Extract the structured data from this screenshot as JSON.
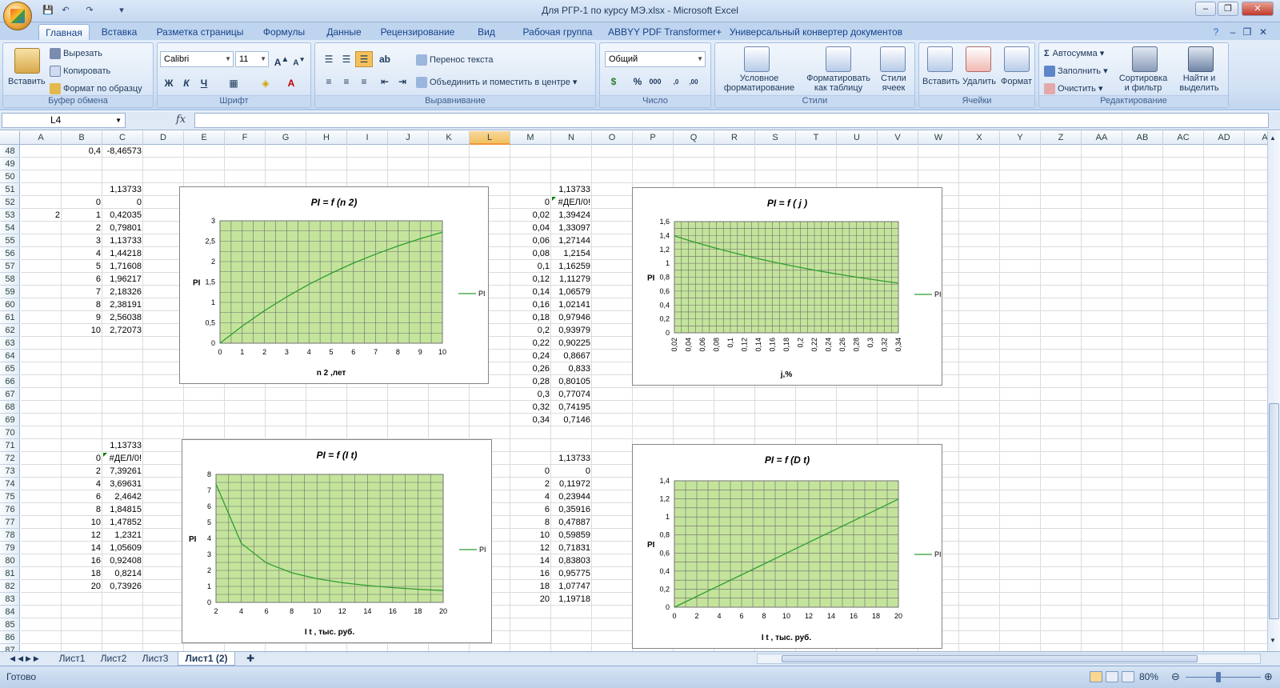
{
  "app": {
    "title": "Для РГР-1 по курсу МЭ.xlsx - Microsoft Excel"
  },
  "tabs": [
    "Главная",
    "Вставка",
    "Разметка страницы",
    "Формулы",
    "Данные",
    "Рецензирование",
    "Вид",
    "Рабочая группа",
    "ABBYY PDF Transformer+",
    "Универсальный конвертер документов"
  ],
  "ribbon": {
    "clipboard": {
      "paste": "Вставить",
      "cut": "Вырезать",
      "copy": "Копировать",
      "format_painter": "Формат по образцу",
      "title": "Буфер обмена"
    },
    "font": {
      "name": "Calibri",
      "size": "11",
      "bold": "Ж",
      "italic": "К",
      "underline": "Ч",
      "title": "Шрифт"
    },
    "alignment": {
      "wrap": "Перенос текста",
      "merge": "Объединить и поместить в центре",
      "title": "Выравнивание"
    },
    "number": {
      "format": "Общий",
      "title": "Число"
    },
    "styles": {
      "conditional": "Условное форматирование",
      "as_table": "Форматировать как таблицу",
      "cell_styles": "Стили ячеек",
      "title": "Стили"
    },
    "cells": {
      "insert": "Вставить",
      "delete": "Удалить",
      "format": "Формат",
      "title": "Ячейки"
    },
    "editing": {
      "autosum": "Автосумма",
      "fill": "Заполнить",
      "clear": "Очистить",
      "sort": "Сортировка и фильтр",
      "find": "Найти и выделить",
      "title": "Редактирование"
    }
  },
  "formula_bar": {
    "name_box": "L4",
    "fx": "fx",
    "value": ""
  },
  "columns": [
    "A",
    "B",
    "C",
    "D",
    "E",
    "F",
    "G",
    "H",
    "I",
    "J",
    "K",
    "L",
    "M",
    "N",
    "O",
    "P",
    "Q",
    "R",
    "S",
    "T",
    "U",
    "V",
    "W",
    "X",
    "Y",
    "Z",
    "AA",
    "AB",
    "AC",
    "AD",
    "A"
  ],
  "rows": [
    "48",
    "49",
    "50",
    "51",
    "52",
    "53",
    "54",
    "55",
    "56",
    "57",
    "58",
    "59",
    "60",
    "61",
    "62",
    "63",
    "64",
    "65",
    "66",
    "67",
    "68",
    "69",
    "70",
    "71",
    "72",
    "73",
    "74",
    "75",
    "76",
    "77",
    "78",
    "79",
    "80",
    "81",
    "82",
    "83",
    "84",
    "85",
    "86",
    "87"
  ],
  "cells": [
    {
      "row": "48",
      "col": "B",
      "v": "0,4"
    },
    {
      "row": "48",
      "col": "C",
      "v": "-8,46573"
    },
    {
      "row": "51",
      "col": "C",
      "v": "1,13733"
    },
    {
      "row": "52",
      "col": "B",
      "v": "0"
    },
    {
      "row": "52",
      "col": "C",
      "v": "0"
    },
    {
      "row": "53",
      "col": "A",
      "v": "2"
    },
    {
      "row": "53",
      "col": "B",
      "v": "1"
    },
    {
      "row": "53",
      "col": "C",
      "v": "0,42035"
    },
    {
      "row": "54",
      "col": "B",
      "v": "2"
    },
    {
      "row": "54",
      "col": "C",
      "v": "0,79801"
    },
    {
      "row": "55",
      "col": "B",
      "v": "3"
    },
    {
      "row": "55",
      "col": "C",
      "v": "1,13733"
    },
    {
      "row": "56",
      "col": "B",
      "v": "4"
    },
    {
      "row": "56",
      "col": "C",
      "v": "1,44218"
    },
    {
      "row": "57",
      "col": "B",
      "v": "5"
    },
    {
      "row": "57",
      "col": "C",
      "v": "1,71608"
    },
    {
      "row": "58",
      "col": "B",
      "v": "6"
    },
    {
      "row": "58",
      "col": "C",
      "v": "1,96217"
    },
    {
      "row": "59",
      "col": "B",
      "v": "7"
    },
    {
      "row": "59",
      "col": "C",
      "v": "2,18326"
    },
    {
      "row": "60",
      "col": "B",
      "v": "8"
    },
    {
      "row": "60",
      "col": "C",
      "v": "2,38191"
    },
    {
      "row": "61",
      "col": "B",
      "v": "9"
    },
    {
      "row": "61",
      "col": "C",
      "v": "2,56038"
    },
    {
      "row": "62",
      "col": "B",
      "v": "10"
    },
    {
      "row": "62",
      "col": "C",
      "v": "2,72073"
    },
    {
      "row": "71",
      "col": "C",
      "v": "1,13733"
    },
    {
      "row": "72",
      "col": "B",
      "v": "0"
    },
    {
      "row": "72",
      "col": "C",
      "v": "#ДЕЛ/0!"
    },
    {
      "row": "73",
      "col": "B",
      "v": "2"
    },
    {
      "row": "73",
      "col": "C",
      "v": "7,39261"
    },
    {
      "row": "74",
      "col": "B",
      "v": "4"
    },
    {
      "row": "74",
      "col": "C",
      "v": "3,69631"
    },
    {
      "row": "75",
      "col": "B",
      "v": "6"
    },
    {
      "row": "75",
      "col": "C",
      "v": "2,4642"
    },
    {
      "row": "76",
      "col": "B",
      "v": "8"
    },
    {
      "row": "76",
      "col": "C",
      "v": "1,84815"
    },
    {
      "row": "77",
      "col": "B",
      "v": "10"
    },
    {
      "row": "77",
      "col": "C",
      "v": "1,47852"
    },
    {
      "row": "78",
      "col": "B",
      "v": "12"
    },
    {
      "row": "78",
      "col": "C",
      "v": "1,2321"
    },
    {
      "row": "79",
      "col": "B",
      "v": "14"
    },
    {
      "row": "79",
      "col": "C",
      "v": "1,05609"
    },
    {
      "row": "80",
      "col": "B",
      "v": "16"
    },
    {
      "row": "80",
      "col": "C",
      "v": "0,92408"
    },
    {
      "row": "81",
      "col": "B",
      "v": "18"
    },
    {
      "row": "81",
      "col": "C",
      "v": "0,8214"
    },
    {
      "row": "82",
      "col": "B",
      "v": "20"
    },
    {
      "row": "82",
      "col": "C",
      "v": "0,73926"
    },
    {
      "row": "51",
      "col": "N",
      "v": "1,13733"
    },
    {
      "row": "52",
      "col": "M",
      "v": "0"
    },
    {
      "row": "52",
      "col": "N",
      "v": "#ДЕЛ/0!"
    },
    {
      "row": "53",
      "col": "M",
      "v": "0,02"
    },
    {
      "row": "53",
      "col": "N",
      "v": "1,39424"
    },
    {
      "row": "54",
      "col": "M",
      "v": "0,04"
    },
    {
      "row": "54",
      "col": "N",
      "v": "1,33097"
    },
    {
      "row": "55",
      "col": "M",
      "v": "0,06"
    },
    {
      "row": "55",
      "col": "N",
      "v": "1,27144"
    },
    {
      "row": "56",
      "col": "M",
      "v": "0,08"
    },
    {
      "row": "56",
      "col": "N",
      "v": "1,2154"
    },
    {
      "row": "57",
      "col": "M",
      "v": "0,1"
    },
    {
      "row": "57",
      "col": "N",
      "v": "1,16259"
    },
    {
      "row": "58",
      "col": "M",
      "v": "0,12"
    },
    {
      "row": "58",
      "col": "N",
      "v": "1,11279"
    },
    {
      "row": "59",
      "col": "M",
      "v": "0,14"
    },
    {
      "row": "59",
      "col": "N",
      "v": "1,06579"
    },
    {
      "row": "60",
      "col": "M",
      "v": "0,16"
    },
    {
      "row": "60",
      "col": "N",
      "v": "1,02141"
    },
    {
      "row": "61",
      "col": "M",
      "v": "0,18"
    },
    {
      "row": "61",
      "col": "N",
      "v": "0,97946"
    },
    {
      "row": "62",
      "col": "M",
      "v": "0,2"
    },
    {
      "row": "62",
      "col": "N",
      "v": "0,93979"
    },
    {
      "row": "63",
      "col": "M",
      "v": "0,22"
    },
    {
      "row": "63",
      "col": "N",
      "v": "0,90225"
    },
    {
      "row": "64",
      "col": "M",
      "v": "0,24"
    },
    {
      "row": "64",
      "col": "N",
      "v": "0,8667"
    },
    {
      "row": "65",
      "col": "M",
      "v": "0,26"
    },
    {
      "row": "65",
      "col": "N",
      "v": "0,833"
    },
    {
      "row": "66",
      "col": "M",
      "v": "0,28"
    },
    {
      "row": "66",
      "col": "N",
      "v": "0,80105"
    },
    {
      "row": "67",
      "col": "M",
      "v": "0,3"
    },
    {
      "row": "67",
      "col": "N",
      "v": "0,77074"
    },
    {
      "row": "68",
      "col": "M",
      "v": "0,32"
    },
    {
      "row": "68",
      "col": "N",
      "v": "0,74195"
    },
    {
      "row": "69",
      "col": "M",
      "v": "0,34"
    },
    {
      "row": "69",
      "col": "N",
      "v": "0,7146"
    },
    {
      "row": "72",
      "col": "N",
      "v": "1,13733"
    },
    {
      "row": "73",
      "col": "M",
      "v": "0"
    },
    {
      "row": "73",
      "col": "N",
      "v": "0"
    },
    {
      "row": "74",
      "col": "M",
      "v": "2"
    },
    {
      "row": "74",
      "col": "N",
      "v": "0,11972"
    },
    {
      "row": "75",
      "col": "M",
      "v": "4"
    },
    {
      "row": "75",
      "col": "N",
      "v": "0,23944"
    },
    {
      "row": "76",
      "col": "M",
      "v": "6"
    },
    {
      "row": "76",
      "col": "N",
      "v": "0,35916"
    },
    {
      "row": "77",
      "col": "M",
      "v": "8"
    },
    {
      "row": "77",
      "col": "N",
      "v": "0,47887"
    },
    {
      "row": "78",
      "col": "M",
      "v": "10"
    },
    {
      "row": "78",
      "col": "N",
      "v": "0,59859"
    },
    {
      "row": "79",
      "col": "M",
      "v": "12"
    },
    {
      "row": "79",
      "col": "N",
      "v": "0,71831"
    },
    {
      "row": "80",
      "col": "M",
      "v": "14"
    },
    {
      "row": "80",
      "col": "N",
      "v": "0,83803"
    },
    {
      "row": "81",
      "col": "M",
      "v": "16"
    },
    {
      "row": "81",
      "col": "N",
      "v": "0,95775"
    },
    {
      "row": "82",
      "col": "M",
      "v": "18"
    },
    {
      "row": "82",
      "col": "N",
      "v": "1,07747"
    },
    {
      "row": "83",
      "col": "M",
      "v": "20"
    },
    {
      "row": "83",
      "col": "N",
      "v": "1,19718"
    }
  ],
  "chart_data": [
    {
      "type": "line",
      "title": "PI = f (n 2)",
      "xlabel": "n 2 ,лет",
      "ylabel": "PI",
      "legend": "PI",
      "x": [
        0,
        1,
        2,
        3,
        4,
        5,
        6,
        7,
        8,
        9,
        10
      ],
      "values": [
        0,
        0.42035,
        0.79801,
        1.13733,
        1.44218,
        1.71608,
        1.96217,
        2.18326,
        2.38191,
        2.56038,
        2.72073
      ],
      "xticks": [
        "0",
        "1",
        "2",
        "3",
        "4",
        "5",
        "6",
        "7",
        "8",
        "9",
        "10"
      ],
      "xlim": [
        0,
        10
      ],
      "yticks": [
        "0",
        "0,5",
        "1",
        "1,5",
        "2",
        "2,5",
        "3"
      ],
      "ylim": [
        0,
        3
      ]
    },
    {
      "type": "line",
      "title": "PI = f ( j )",
      "xlabel": "j,%",
      "ylabel": "PI",
      "legend": "PI",
      "x": [
        0.02,
        0.04,
        0.06,
        0.08,
        0.1,
        0.12,
        0.14,
        0.16,
        0.18,
        0.2,
        0.22,
        0.24,
        0.26,
        0.28,
        0.3,
        0.32,
        0.34
      ],
      "values": [
        1.39424,
        1.33097,
        1.27144,
        1.2154,
        1.16259,
        1.11279,
        1.06579,
        1.02141,
        0.97946,
        0.93979,
        0.90225,
        0.8667,
        0.833,
        0.80105,
        0.77074,
        0.74195,
        0.7146
      ],
      "xticks": [
        "0,02",
        "0,04",
        "0,06",
        "0,08",
        "0,1",
        "0,12",
        "0,14",
        "0,16",
        "0,18",
        "0,2",
        "0,22",
        "0,24",
        "0,26",
        "0,28",
        "0,3",
        "0,32",
        "0,34"
      ],
      "xlim": [
        0.02,
        0.34
      ],
      "yticks": [
        "0",
        "0,2",
        "0,4",
        "0,6",
        "0,8",
        "1",
        "1,2",
        "1,4",
        "1,6"
      ],
      "ylim": [
        0,
        1.6
      ]
    },
    {
      "type": "line",
      "title": "PI = f (I t)",
      "xlabel": "I t , тыс. руб.",
      "ylabel": "PI",
      "legend": "PI",
      "x": [
        2,
        4,
        6,
        8,
        10,
        12,
        14,
        16,
        18,
        20
      ],
      "values": [
        7.39261,
        3.69631,
        2.4642,
        1.84815,
        1.47852,
        1.2321,
        1.05609,
        0.92408,
        0.8214,
        0.73926
      ],
      "xticks": [
        "2",
        "4",
        "6",
        "8",
        "10",
        "12",
        "14",
        "16",
        "18",
        "20"
      ],
      "xlim": [
        2,
        20
      ],
      "yticks": [
        "0",
        "1",
        "2",
        "3",
        "4",
        "5",
        "6",
        "7",
        "8"
      ],
      "ylim": [
        0,
        8
      ]
    },
    {
      "type": "line",
      "title": "PI = f (D t)",
      "xlabel": "I t , тыс. руб.",
      "ylabel": "PI",
      "legend": "PI",
      "x": [
        0,
        2,
        4,
        6,
        8,
        10,
        12,
        14,
        16,
        18,
        20
      ],
      "values": [
        0,
        0.11972,
        0.23944,
        0.35916,
        0.47887,
        0.59859,
        0.71831,
        0.83803,
        0.95775,
        1.07747,
        1.19718
      ],
      "xticks": [
        "0",
        "2",
        "4",
        "6",
        "8",
        "10",
        "12",
        "14",
        "16",
        "18",
        "20"
      ],
      "xlim": [
        0,
        20
      ],
      "yticks": [
        "0",
        "0,2",
        "0,4",
        "0,6",
        "0,8",
        "1",
        "1,2",
        "1,4"
      ],
      "ylim": [
        0,
        1.4
      ]
    }
  ],
  "colors": {
    "plot_bg": "#c4e49c",
    "line": "#2f9e2f",
    "grid": "#6b6b6b"
  },
  "sheet_tabs": [
    "Лист1",
    "Лист2",
    "Лист3",
    "Лист1 (2)"
  ],
  "status": {
    "ready": "Готово",
    "zoom": "80%"
  }
}
